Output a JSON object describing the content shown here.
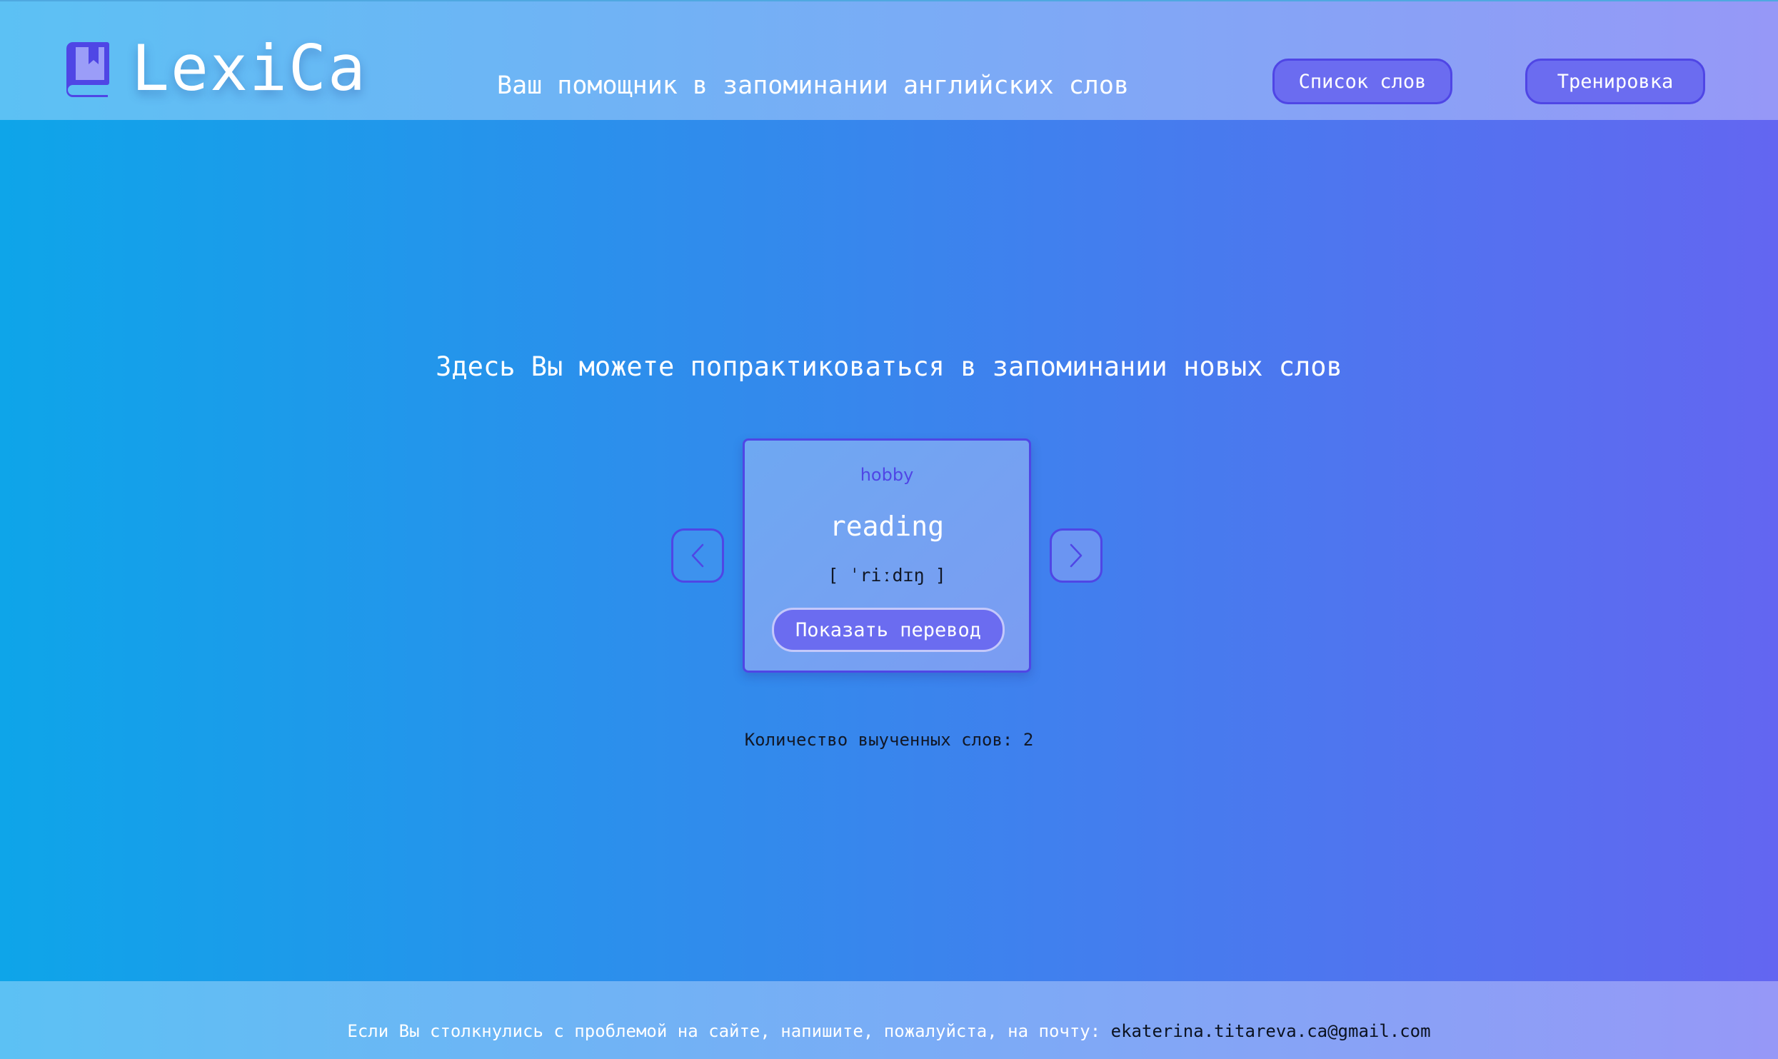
{
  "header": {
    "logo_text": "LexiCa",
    "tagline": "Ваш помощник в запоминании английских слов",
    "nav": {
      "words_label": "Список слов",
      "training_label": "Тренировка"
    }
  },
  "main": {
    "heading": "Здесь Вы можете попрактиковаться в запоминании новых слов",
    "card": {
      "topic": "hobby",
      "word": "reading",
      "transcription": "[ ˈriːdɪŋ ]",
      "show_translation_label": "Показать перевод"
    },
    "learned_counter": "Количество выученных слов: 2"
  },
  "footer": {
    "text": "Если Вы столкнулись с проблемой на сайте, напишите, пожалуйста, на почту:",
    "email": "ekaterina.titareva.ca@gmail.com"
  },
  "icons": {
    "logo": "book-icon",
    "prev": "chevron-left-icon",
    "next": "chevron-right-icon"
  },
  "colors": {
    "accent": "#4f46e5",
    "button": "#6b6cf0",
    "gradient_start": "#0ea5e9",
    "gradient_end": "#6366f1"
  }
}
